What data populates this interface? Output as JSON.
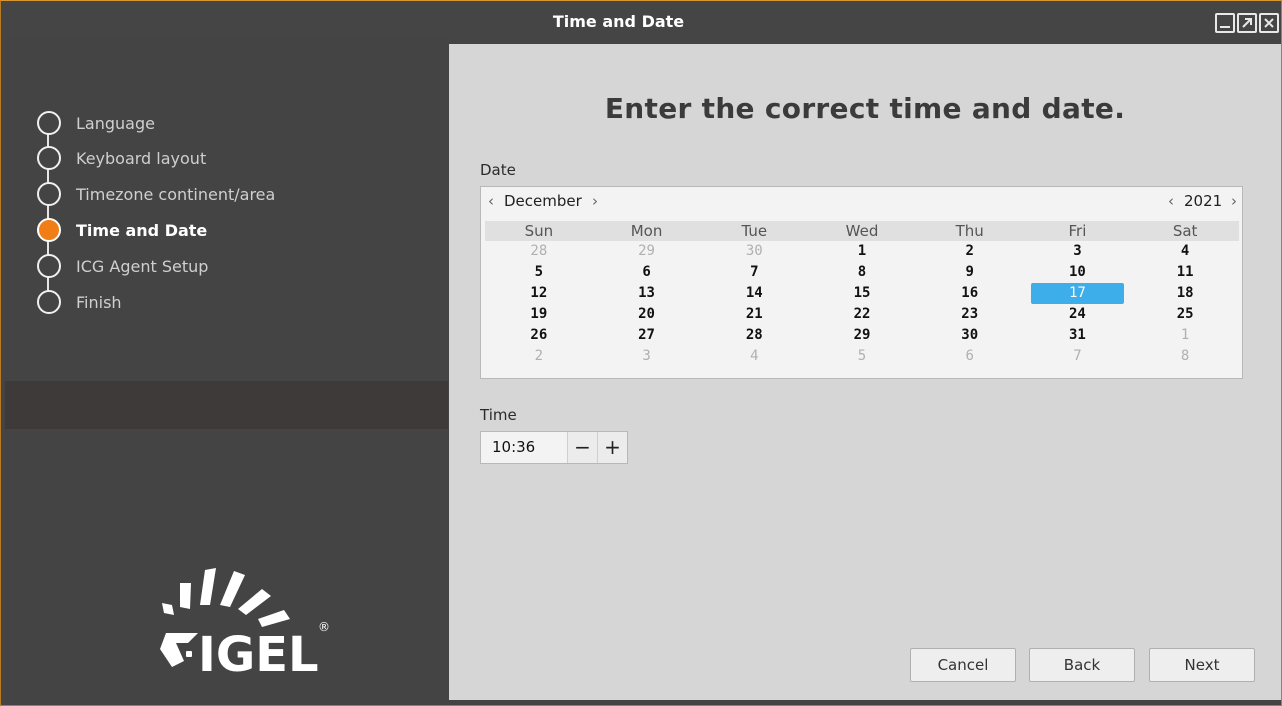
{
  "window": {
    "title": "Time and Date",
    "controls": [
      "minimize-icon",
      "maximize-icon",
      "close-icon"
    ]
  },
  "steps": [
    {
      "label": "Language",
      "active": false
    },
    {
      "label": "Keyboard layout",
      "active": false
    },
    {
      "label": "Timezone continent/area",
      "active": false
    },
    {
      "label": "Time and Date",
      "active": true
    },
    {
      "label": "ICG Agent Setup",
      "active": false
    },
    {
      "label": "Finish",
      "active": false
    }
  ],
  "logo": {
    "text": "IGEL",
    "mark": "®"
  },
  "content": {
    "heading": "Enter the correct time and date.",
    "date_label": "Date",
    "time_label": "Time"
  },
  "calendar": {
    "month": "December",
    "year": "2021",
    "prev_arrow": "‹",
    "next_arrow": "›",
    "weekdays": [
      "Sun",
      "Mon",
      "Tue",
      "Wed",
      "Thu",
      "Fri",
      "Sat"
    ],
    "weeks": [
      [
        {
          "d": "28",
          "m": true
        },
        {
          "d": "29",
          "m": true
        },
        {
          "d": "30",
          "m": true
        },
        {
          "d": "1"
        },
        {
          "d": "2"
        },
        {
          "d": "3"
        },
        {
          "d": "4"
        }
      ],
      [
        {
          "d": "5"
        },
        {
          "d": "6"
        },
        {
          "d": "7"
        },
        {
          "d": "8"
        },
        {
          "d": "9"
        },
        {
          "d": "10"
        },
        {
          "d": "11"
        }
      ],
      [
        {
          "d": "12"
        },
        {
          "d": "13"
        },
        {
          "d": "14"
        },
        {
          "d": "15"
        },
        {
          "d": "16"
        },
        {
          "d": "17",
          "s": true
        },
        {
          "d": "18"
        }
      ],
      [
        {
          "d": "19"
        },
        {
          "d": "20"
        },
        {
          "d": "21"
        },
        {
          "d": "22"
        },
        {
          "d": "23"
        },
        {
          "d": "24"
        },
        {
          "d": "25"
        }
      ],
      [
        {
          "d": "26"
        },
        {
          "d": "27"
        },
        {
          "d": "28"
        },
        {
          "d": "29"
        },
        {
          "d": "30"
        },
        {
          "d": "31"
        },
        {
          "d": "1",
          "m": true
        }
      ],
      [
        {
          "d": "2",
          "m": true
        },
        {
          "d": "3",
          "m": true
        },
        {
          "d": "4",
          "m": true
        },
        {
          "d": "5",
          "m": true
        },
        {
          "d": "6",
          "m": true
        },
        {
          "d": "7",
          "m": true
        },
        {
          "d": "8",
          "m": true
        }
      ]
    ],
    "selected_color": "#3daee9"
  },
  "time": {
    "value": "10:36",
    "minus": "−",
    "plus": "+"
  },
  "buttons": {
    "cancel": "Cancel",
    "back": "Back",
    "next": "Next"
  },
  "colors": {
    "accent": "#f07d16",
    "sidebar": "#444444",
    "content": "#d6d6d6"
  }
}
